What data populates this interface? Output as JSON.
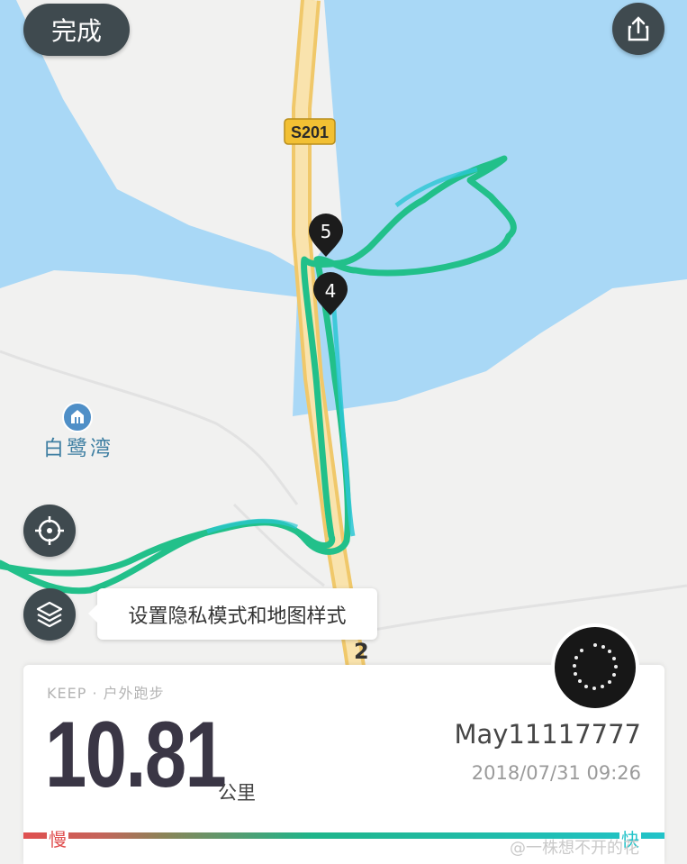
{
  "header": {
    "done_label": "完成",
    "share_icon": "share-icon"
  },
  "map": {
    "road_label": "S201",
    "route_number": "2",
    "place_name": "白鹭湾",
    "markers": [
      "5",
      "4"
    ],
    "colors": {
      "water": "#a9d8f6",
      "land": "#f1f1f0",
      "track": "#22c08a",
      "track_fast": "#2bc7d3",
      "road": "#f6d38a"
    }
  },
  "controls": {
    "locate_icon": "crosshair-icon",
    "layers_icon": "layers-icon",
    "tooltip_text": "设置隐私模式和地图样式"
  },
  "summary": {
    "source": "KEEP · 户外跑步",
    "distance": "10.81",
    "unit": "公里",
    "username": "May11117777",
    "datetime": "2018/07/31 09:26",
    "pace_slow": "慢",
    "pace_fast": "快"
  },
  "watermark": "@一株想不开的花"
}
